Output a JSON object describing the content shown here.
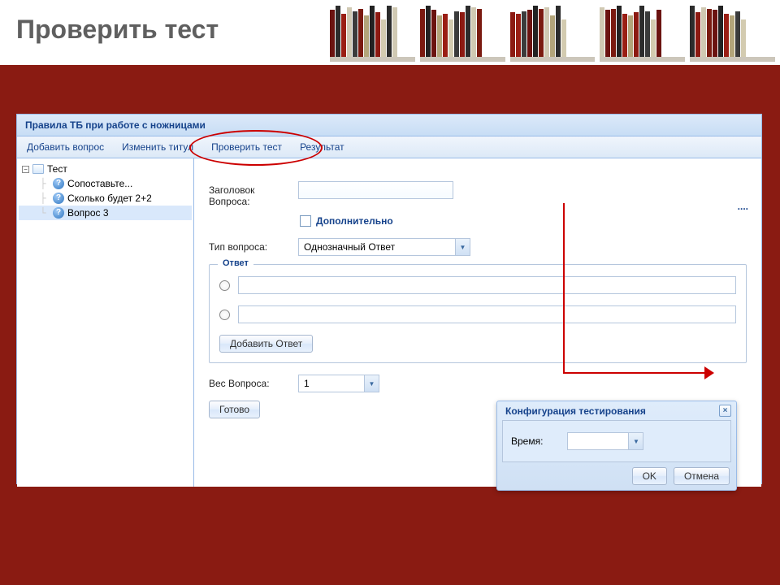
{
  "page_heading": "Проверить тест",
  "window": {
    "title": "Правила ТБ при работе с ножницами"
  },
  "toolbar": {
    "add_question": "Добавить вопрос",
    "edit_title": "Изменить титул",
    "check_test": "Проверить тест",
    "result": "Результат"
  },
  "tree": {
    "root": "Тест",
    "items": [
      "Сопоставьте...",
      "Сколько будет 2+2",
      "Вопрос 3"
    ]
  },
  "form": {
    "title_label": "Заголовок Вопроса:",
    "title_value": "",
    "additional_label": "Дополнительно",
    "type_label": "Тип вопроса:",
    "type_value": "Однозначный Ответ",
    "answers_legend": "Ответ",
    "answer1": "",
    "answer2": "",
    "add_answer_btn": "Добавить Ответ",
    "weight_label": "Вес Вопроса:",
    "weight_value": "1",
    "done_btn": "Готово"
  },
  "dialog": {
    "title": "Конфигурация тестирования",
    "time_label": "Время:",
    "time_value": "",
    "ok": "OK",
    "cancel": "Отмена"
  }
}
